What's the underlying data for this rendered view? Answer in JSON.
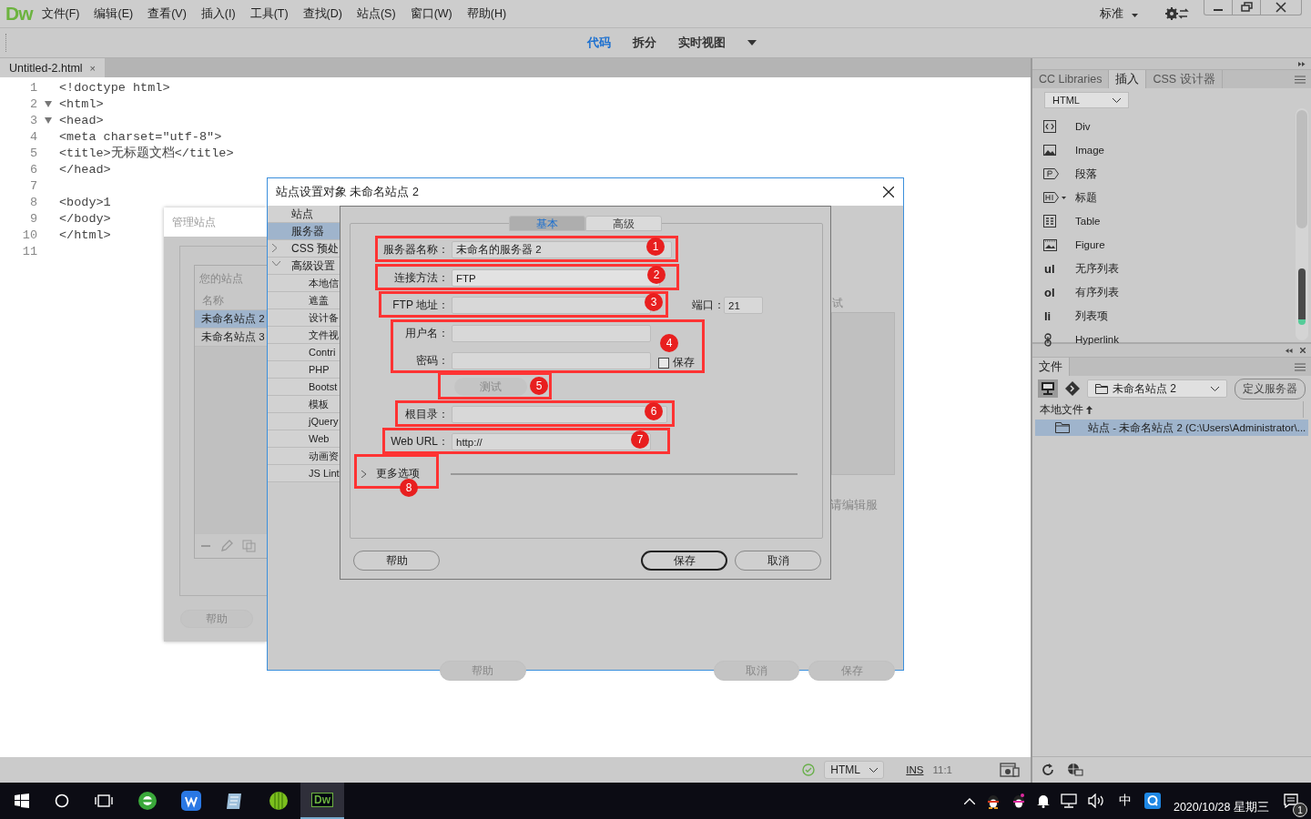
{
  "app": {
    "logo": "Dw",
    "menus": [
      "文件(F)",
      "编辑(E)",
      "查看(V)",
      "插入(I)",
      "工具(T)",
      "查找(D)",
      "站点(S)",
      "窗口(W)",
      "帮助(H)"
    ],
    "workspace": "标准"
  },
  "view_switcher": [
    {
      "label": "代码",
      "selected": true
    },
    {
      "label": "拆分",
      "selected": false
    },
    {
      "label": "实时视图",
      "selected": false
    }
  ],
  "document_tabs": [
    {
      "label": "Untitled-2.html",
      "close": "×",
      "selected": true
    }
  ],
  "code_lines": [
    {
      "number": "1",
      "text": "<!doctype html>",
      "foldable": false
    },
    {
      "number": "2",
      "text": "<html>",
      "foldable": true
    },
    {
      "number": "3",
      "text": "<head>",
      "foldable": true
    },
    {
      "number": "4",
      "text": "<meta charset=\"utf-8\">",
      "foldable": false
    },
    {
      "number": "5",
      "text": "<title>无标题文档</title>",
      "foldable": false
    },
    {
      "number": "6",
      "text": "</head>",
      "foldable": false
    },
    {
      "number": "7",
      "foldable": false
    },
    {
      "number": "8",
      "text": "<body>1",
      "foldable": false
    },
    {
      "number": "9",
      "text": "</body>",
      "foldable": false
    },
    {
      "number": "10",
      "text": "</html>",
      "foldable": false
    },
    {
      "number": "11",
      "foldable": false
    }
  ],
  "manage_sites_dialog": {
    "title": "管理站点",
    "heading": "您的站点",
    "column": "名称",
    "sites": [
      {
        "name": "未命名站点 2",
        "selected": true
      },
      {
        "name": "未命名站点 3",
        "selected": false
      }
    ],
    "help_button": "帮助"
  },
  "site_setup_dialog": {
    "title": "站点设置对象 未命名站点 2",
    "nav": [
      {
        "label": "站点",
        "kind": "leaf",
        "selected": false
      },
      {
        "label": "服务器",
        "kind": "leaf",
        "selected": true
      },
      {
        "label": "CSS 预处",
        "kind": "group",
        "expanded": false,
        "selected": false
      },
      {
        "label": "高级设置",
        "kind": "group",
        "expanded": true,
        "selected": false,
        "children": [
          {
            "label": "本地信",
            "selected": false
          },
          {
            "label": "遮盖",
            "selected": false
          },
          {
            "label": "设计备",
            "selected": false
          },
          {
            "label": "文件视",
            "selected": false
          },
          {
            "label": "Contri",
            "selected": false
          },
          {
            "label": "PHP",
            "selected": false
          },
          {
            "label": "Bootst",
            "selected": false
          },
          {
            "label": "模板",
            "selected": false
          },
          {
            "label": "jQuery",
            "selected": false
          },
          {
            "label": "Web",
            "selected": false
          },
          {
            "label": "动画资",
            "selected": false
          },
          {
            "label": "JS Lint",
            "selected": false
          }
        ]
      }
    ],
    "column_fragment": "试",
    "hint_fragment": "请编辑服",
    "buttons": [
      {
        "label": "帮助",
        "disabled": true
      },
      {
        "label": "取消",
        "disabled": true
      },
      {
        "label": "保存",
        "disabled": true
      }
    ]
  },
  "server_dialog": {
    "tabs": [
      {
        "label": "基本",
        "selected": true
      },
      {
        "label": "高级",
        "selected": false
      }
    ],
    "fields": [
      {
        "label": "服务器名称：",
        "value": "未命名的服务器 2",
        "kind": "text"
      },
      {
        "label": "连接方法：",
        "value": "FTP",
        "kind": "select"
      },
      {
        "label": "FTP 地址：",
        "kind": "text"
      },
      {
        "label": "用户名：",
        "kind": "text"
      },
      {
        "label": "密码：",
        "kind": "text"
      },
      {
        "label": "根目录：",
        "kind": "text"
      },
      {
        "label": "Web URL：",
        "value": "http://",
        "kind": "text"
      }
    ],
    "port": {
      "label": "端口：",
      "value": "21"
    },
    "save_password": {
      "label": "保存",
      "checked": false
    },
    "test_button": {
      "label": "测试",
      "disabled": true
    },
    "more_options": {
      "label": "更多选项",
      "expanded": false
    },
    "buttons": [
      {
        "label": "帮助",
        "default": false
      },
      {
        "label": "保存",
        "default": true
      },
      {
        "label": "取消",
        "default": false
      }
    ]
  },
  "annotations": [
    {
      "number": "1"
    },
    {
      "number": "2"
    },
    {
      "number": "3"
    },
    {
      "number": "4"
    },
    {
      "number": "5"
    },
    {
      "number": "6"
    },
    {
      "number": "7"
    },
    {
      "number": "8"
    }
  ],
  "insert_panel": {
    "tabs": [
      {
        "label": "CC Libraries",
        "selected": false
      },
      {
        "label": "插入",
        "selected": true
      },
      {
        "label": "CSS 设计器",
        "selected": false
      }
    ],
    "category": "HTML",
    "items": [
      {
        "label": "Div",
        "kind": "div"
      },
      {
        "label": "Image",
        "kind": "image"
      },
      {
        "label": "段落",
        "kind": "paragraph"
      },
      {
        "label": "标题",
        "kind": "heading"
      },
      {
        "label": "Table",
        "kind": "table"
      },
      {
        "label": "Figure",
        "kind": "figure"
      },
      {
        "label": "无序列表",
        "kind": "tag",
        "tag": "ul"
      },
      {
        "label": "有序列表",
        "kind": "tag",
        "tag": "ol"
      },
      {
        "label": "列表项",
        "kind": "tag",
        "tag": "li"
      },
      {
        "label": "Hyperlink",
        "kind": "link"
      }
    ]
  },
  "files_panel": {
    "tab": "文件",
    "site": "未命名站点 2",
    "define_button": "定义服务器",
    "column": "本地文件",
    "rows": [
      {
        "label": "站点 - 未命名站点 2 (C:\\Users\\Administrator\\...",
        "selected": true
      }
    ]
  },
  "status_bar": {
    "language": "HTML",
    "mode": "INS",
    "position": "11:1"
  },
  "taskbar": {
    "active_app": "Dw",
    "ime": "中",
    "date": "2020/10/28 星期三",
    "notifications": "1"
  }
}
